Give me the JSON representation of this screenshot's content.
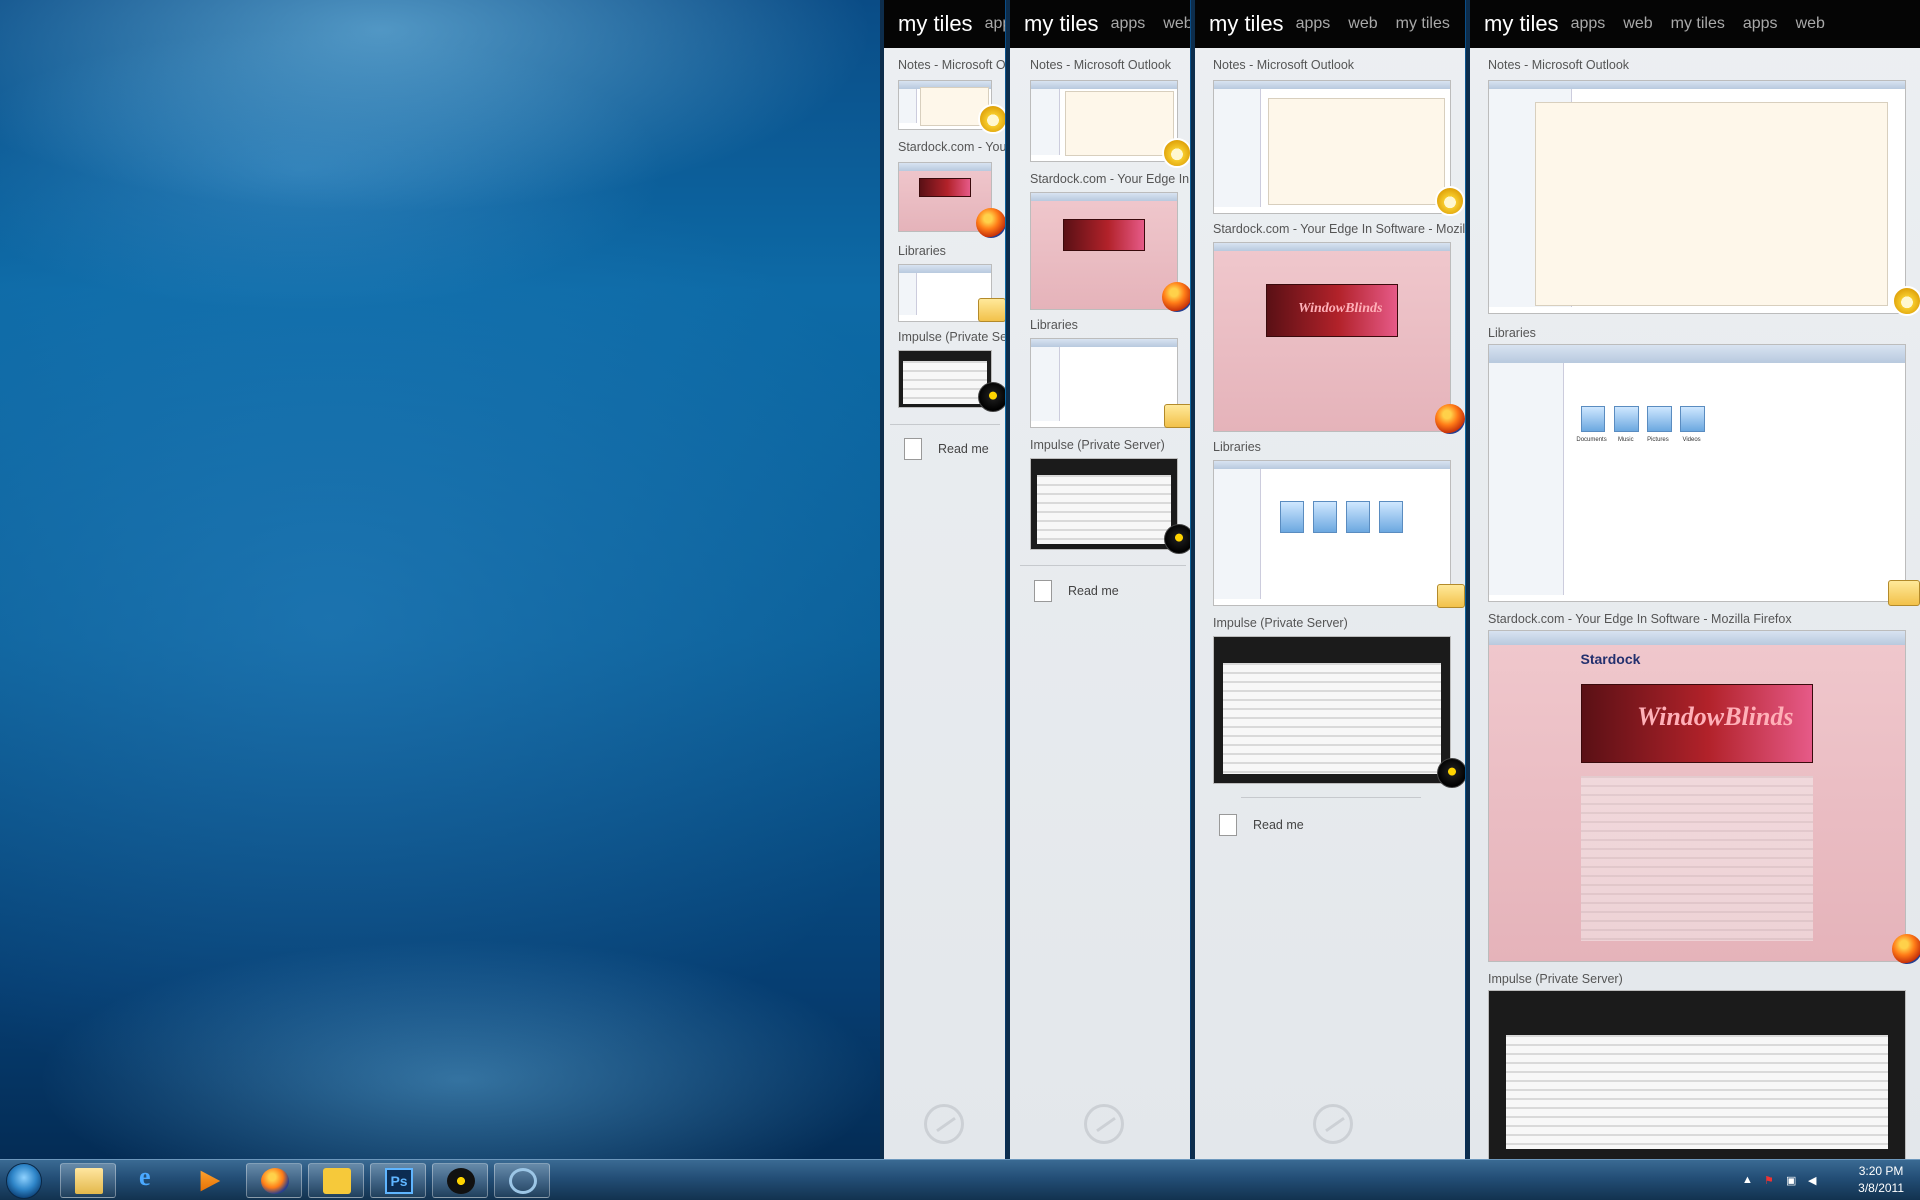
{
  "header": {
    "title": "my tiles",
    "nav": [
      "apps",
      "web",
      "my tiles",
      "apps",
      "web"
    ]
  },
  "tiles": {
    "outlook": "Notes - Microsoft Outlook",
    "stardock": "Stardock.com - Your Edge In Software - Mozilla Firefox",
    "libraries": "Libraries",
    "impulse": "Impulse (Private Server)",
    "readme": "Read me"
  },
  "previews": {
    "windowblinds": "WindowBlinds",
    "stardock_logo": "Stardock",
    "folders": [
      "Documents",
      "Music",
      "Pictures",
      "Videos"
    ]
  },
  "icons": {
    "outlook": "outlook-icon",
    "firefox": "firefox-icon",
    "libraries": "libraries-folder-icon",
    "impulse": "impulse-icon",
    "readme": "document-icon",
    "panel_logo": "stardock-logo-icon"
  },
  "taskbar": {
    "pinned": [
      "explorer-icon",
      "internet-explorer-icon",
      "media-player-icon",
      "firefox-icon",
      "outlook-icon",
      "photoshop-icon",
      "impulse-icon",
      "rings-app-icon"
    ],
    "ps_label": "Ps",
    "ie_label": "e"
  },
  "clock": {
    "time": "3:20 PM",
    "date": "3/8/2011"
  }
}
